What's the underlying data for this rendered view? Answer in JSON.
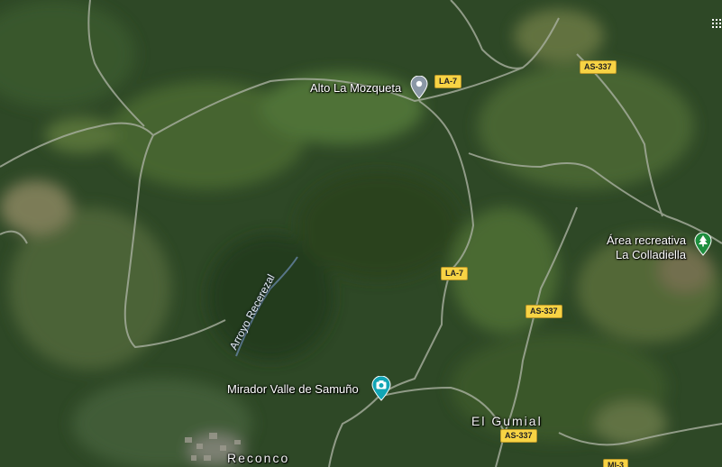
{
  "places": {
    "alto": "Alto La Mozqueta",
    "mirador": "Mirador Valle de Samuño",
    "area_line1": "Área recreativa",
    "area_line2": "La Colladiella",
    "gumial": "El Gumial",
    "reconco": "Reconco"
  },
  "roads": {
    "la7_top": "LA-7",
    "la7_mid": "LA-7",
    "as337_top": "AS-337",
    "as337_mid": "AS-337",
    "as337_bottom": "AS-337",
    "mi3": "MI-3"
  },
  "waterways": {
    "arroyo": "Arroyo Recerezal"
  },
  "icons": {
    "alto_pin": "place-pin-icon",
    "mirador_pin": "camera-pin-icon",
    "area_pin": "tree-pin-icon",
    "grid": "grid-menu-icon"
  },
  "colors": {
    "place_pin": "#8a97a6",
    "camera_pin": "#12a5b5",
    "tree_pin": "#1e8e3e",
    "shield": "#f7d344"
  }
}
